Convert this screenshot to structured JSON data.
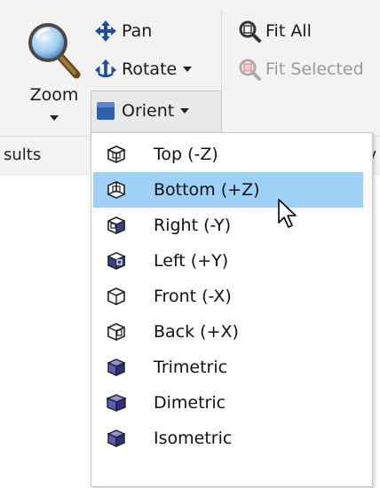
{
  "ribbon": {
    "zoom_label": "Zoom",
    "pan_label": "Pan",
    "rotate_label": "Rotate",
    "orient_label": "Orient",
    "fit_all_label": "Fit All",
    "fit_selected_label": "Fit Selected",
    "results_group_label": "sults",
    "next_group_label": "rv"
  },
  "orient_menu": {
    "items": [
      {
        "label": "Top (-Z)",
        "icon": "cube-top-icon",
        "highlighted": false
      },
      {
        "label": "Bottom (+Z)",
        "icon": "cube-bottom-icon",
        "highlighted": true
      },
      {
        "label": "Right (-Y)",
        "icon": "cube-right-icon",
        "highlighted": false
      },
      {
        "label": "Left (+Y)",
        "icon": "cube-left-icon",
        "highlighted": false
      },
      {
        "label": "Front (-X)",
        "icon": "cube-front-icon",
        "highlighted": false
      },
      {
        "label": "Back (+X)",
        "icon": "cube-back-icon",
        "highlighted": false
      },
      {
        "label": "Trimetric",
        "icon": "cube-trimetric-icon",
        "highlighted": false
      },
      {
        "label": "Dimetric",
        "icon": "cube-dimetric-icon",
        "highlighted": false
      },
      {
        "label": "Isometric",
        "icon": "cube-isometric-icon",
        "highlighted": false
      }
    ]
  },
  "colors": {
    "highlight": "#9fd0f5",
    "ribbon_bg": "#f3f3f3",
    "icon_blue": "#2f5fb0"
  }
}
